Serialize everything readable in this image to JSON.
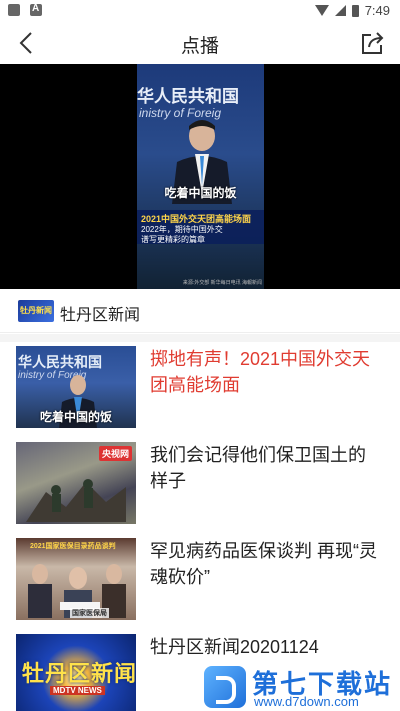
{
  "status_bar": {
    "time": "7:49"
  },
  "header": {
    "title": "点播",
    "back_icon": "back-arrow-icon",
    "share_icon": "share-icon"
  },
  "video": {
    "banner_text": "华人民共和国",
    "banner_sub": "inistry of Foreig",
    "caption": "吃着中国的饭",
    "box_title": "2021中国外交天团高能场面",
    "box_line1": "2022年，期待中国外交",
    "box_line2": "谱写更精彩的篇章",
    "source_text": "来源:外交部 新华每日电讯 海報新闻"
  },
  "channel": {
    "logo_text": "牡丹新闻",
    "name": "牡丹区新闻"
  },
  "list": [
    {
      "title": "掷地有声！2021中国外交天团高能场面",
      "active": true,
      "thumb_banner": "华人民共和国",
      "thumb_sub": "inistry of Foreig",
      "thumb_caption": "吃着中国的饭"
    },
    {
      "title": "我们会记得他们保卫国土的样子",
      "active": false,
      "thumb_badge": "央视网"
    },
    {
      "title": "罕见病药品医保谈判 再现“灵魂砍价”",
      "active": false,
      "thumb_banner": "2021国家医保目录药品谈判",
      "thumb_caption": "国家医保局"
    },
    {
      "title": "牡丹区新闻20201124",
      "active": false,
      "thumb_banner": "牡丹区新闻",
      "thumb_caption": "MDTV NEWS"
    }
  ],
  "watermark": {
    "title": "第七下载站",
    "url": "www.d7down.com"
  },
  "colors": {
    "active_title": "#e03c31",
    "watermark_blue": "#1e6fd9"
  }
}
